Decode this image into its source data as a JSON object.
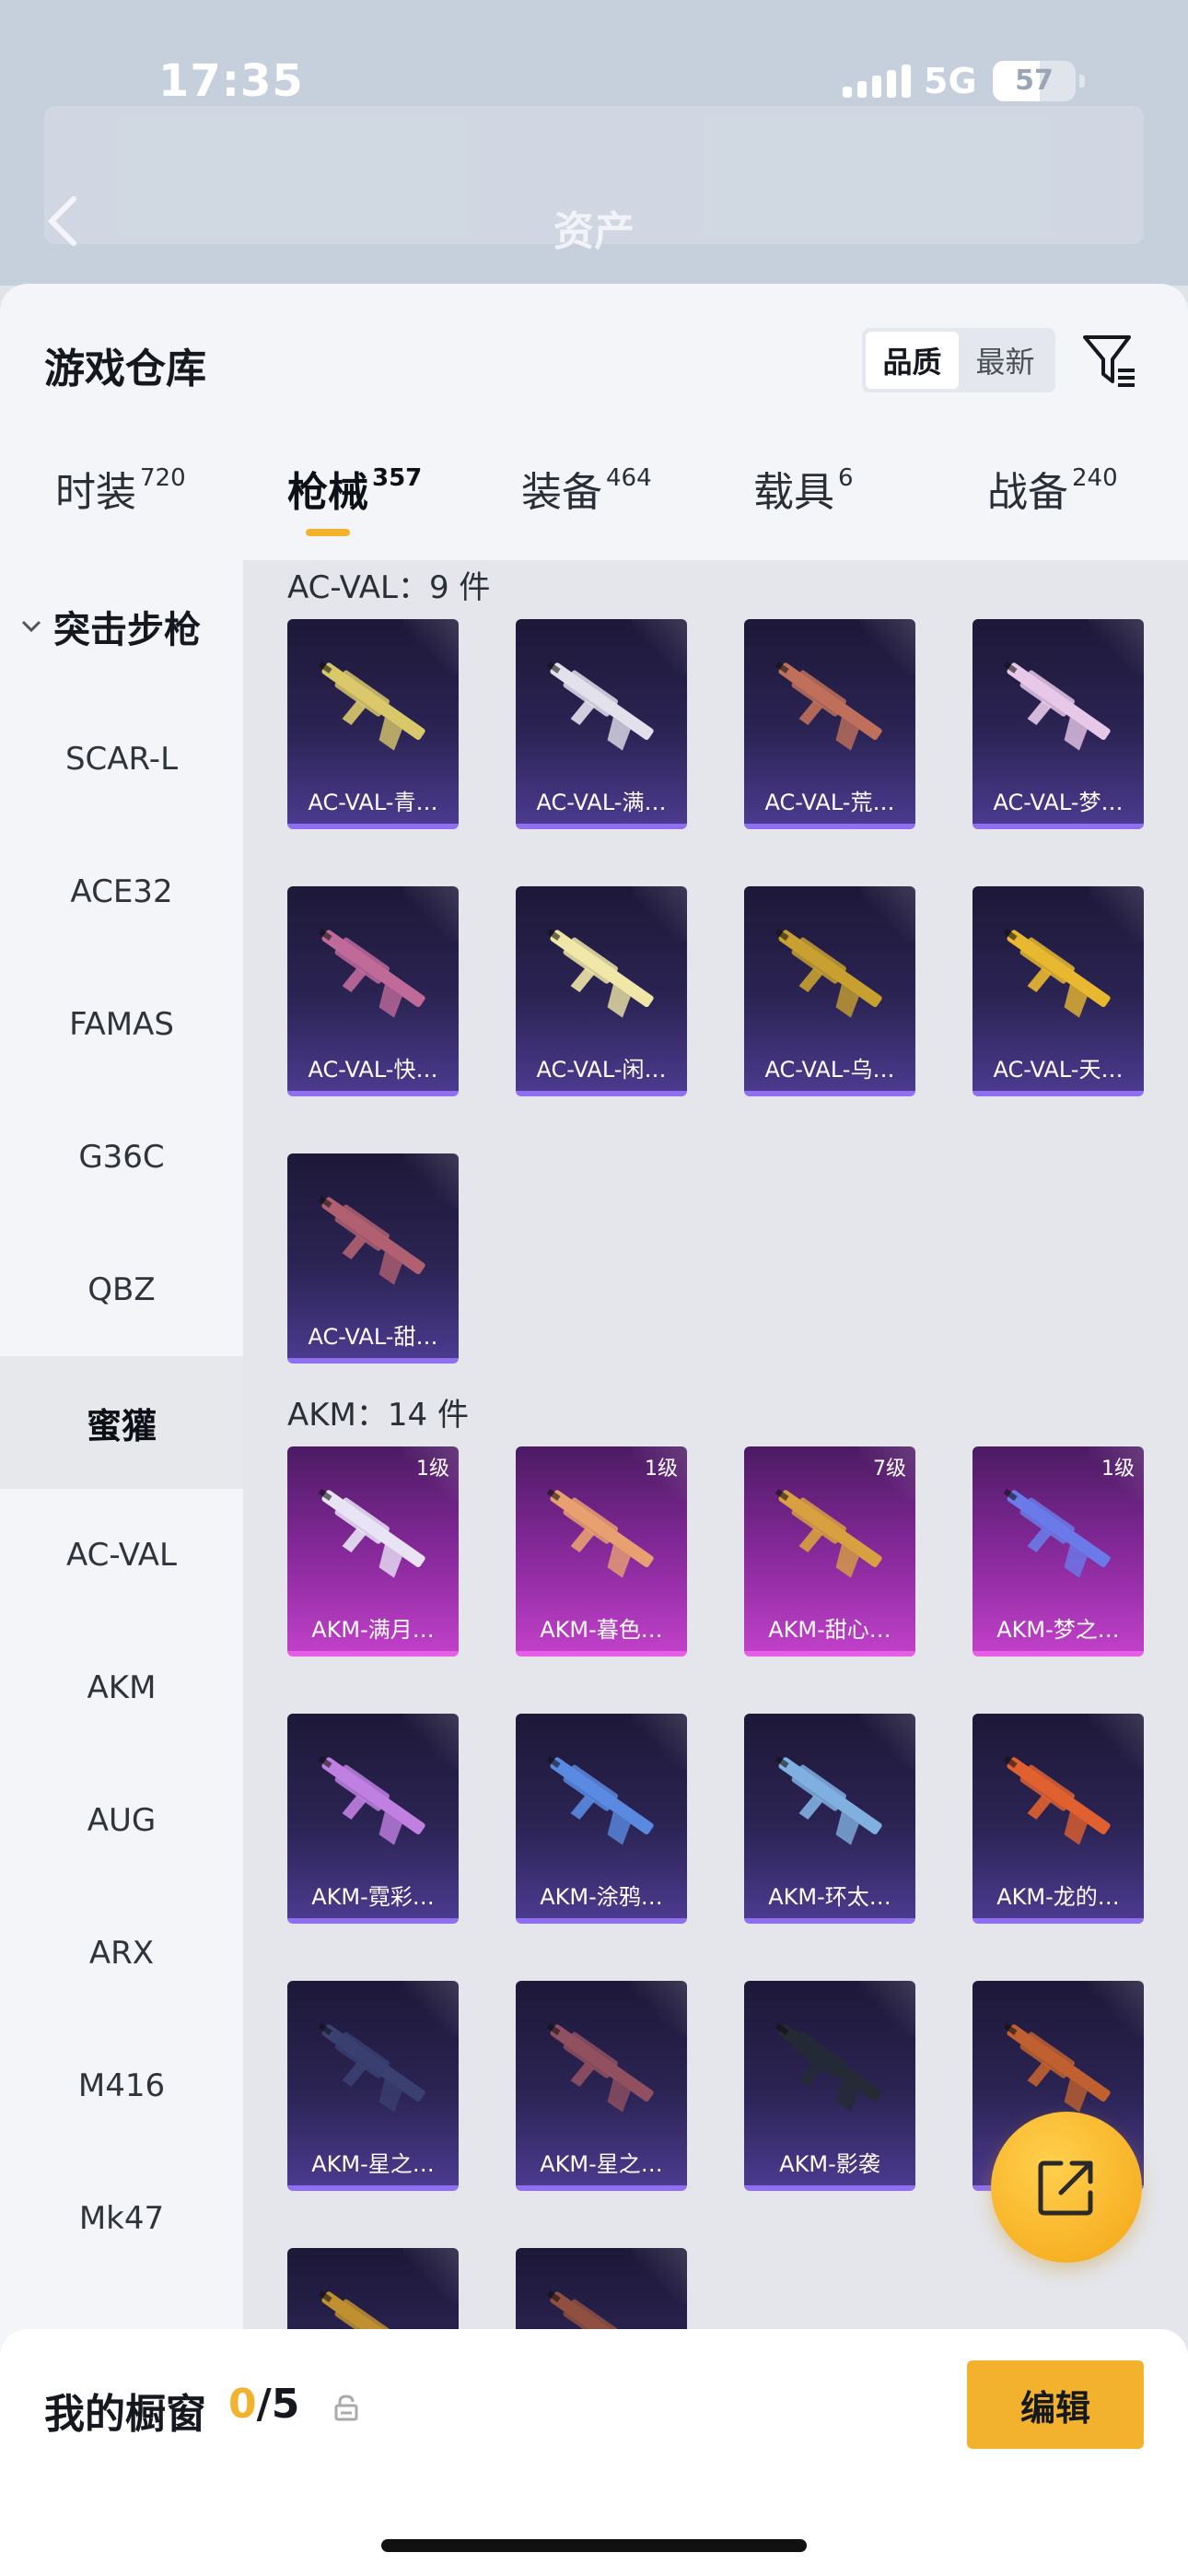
{
  "status_bar": {
    "time": "17:35",
    "network": "5G",
    "battery": "57"
  },
  "nav": {
    "title": "资产"
  },
  "sheet": {
    "title": "游戏仓库",
    "sort_options": [
      "品质",
      "最新"
    ],
    "sort_selected": "品质"
  },
  "tabs": [
    {
      "label": "时装",
      "count": "720"
    },
    {
      "label": "枪械",
      "count": "357"
    },
    {
      "label": "装备",
      "count": "464"
    },
    {
      "label": "载具",
      "count": "6"
    },
    {
      "label": "战备",
      "count": "240"
    }
  ],
  "sidebar": {
    "group": "突击步枪",
    "items": [
      "SCAR-L",
      "ACE32",
      "FAMAS",
      "G36C",
      "QBZ",
      "蜜獾",
      "AC-VAL",
      "AKM",
      "AUG",
      "ARX",
      "M416",
      "Mk47"
    ],
    "active": "蜜獾"
  },
  "sections": [
    {
      "label": "AC-VAL：9 件",
      "items": [
        {
          "name": "AC-VAL-青…",
          "rarity": "blue",
          "gun_color": "#d9c86a"
        },
        {
          "name": "AC-VAL-满…",
          "rarity": "blue",
          "gun_color": "#e3e0ec"
        },
        {
          "name": "AC-VAL-荒…",
          "rarity": "blue",
          "gun_color": "#c0705a"
        },
        {
          "name": "AC-VAL-梦…",
          "rarity": "blue",
          "gun_color": "#e8c8e8"
        },
        {
          "name": "AC-VAL-快…",
          "rarity": "blue",
          "gun_color": "#c06a9a"
        },
        {
          "name": "AC-VAL-闲…",
          "rarity": "blue",
          "gun_color": "#f0e6a8"
        },
        {
          "name": "AC-VAL-乌…",
          "rarity": "blue",
          "gun_color": "#c8a030"
        },
        {
          "name": "AC-VAL-天…",
          "rarity": "blue",
          "gun_color": "#e8b830"
        },
        {
          "name": "AC-VAL-甜…",
          "rarity": "blue",
          "gun_color": "#b06070"
        }
      ]
    },
    {
      "label": "AKM：14 件",
      "items": [
        {
          "name": "AKM-满月…",
          "rarity": "purple",
          "level": "1级",
          "gun_color": "#e8e4f4"
        },
        {
          "name": "AKM-暮色…",
          "rarity": "purple",
          "level": "1级",
          "gun_color": "#e8a070"
        },
        {
          "name": "AKM-甜心…",
          "rarity": "purple",
          "level": "7级",
          "gun_color": "#d8a040"
        },
        {
          "name": "AKM-梦之…",
          "rarity": "purple",
          "level": "1级",
          "gun_color": "#6a7ae8"
        },
        {
          "name": "AKM-霓彩…",
          "rarity": "blue",
          "gun_color": "#c080e0"
        },
        {
          "name": "AKM-涂鸦…",
          "rarity": "blue",
          "gun_color": "#5a8ae0"
        },
        {
          "name": "AKM-环太…",
          "rarity": "blue",
          "gun_color": "#80b0e0"
        },
        {
          "name": "AKM-龙的…",
          "rarity": "blue",
          "gun_color": "#e06030"
        },
        {
          "name": "AKM-星之…",
          "rarity": "blue",
          "gun_color": "#3a4070"
        },
        {
          "name": "AKM-星之…",
          "rarity": "blue",
          "gun_color": "#905060"
        },
        {
          "name": "AKM-影袭",
          "rarity": "blue",
          "gun_color": "#252a35"
        },
        {
          "name": "",
          "rarity": "blue",
          "gun_color": "#c06030"
        },
        {
          "name": "",
          "rarity": "blue",
          "gun_color": "#c09030"
        },
        {
          "name": "",
          "rarity": "blue",
          "gun_color": "#905040"
        }
      ]
    }
  ],
  "showcase": {
    "label": "我的橱窗",
    "current": "0",
    "total": "/5",
    "edit_label": "编辑"
  },
  "colors": {
    "accent": "#f3b22e",
    "blue_card": "#2b2454",
    "purple_card": "#8a2a9e"
  }
}
